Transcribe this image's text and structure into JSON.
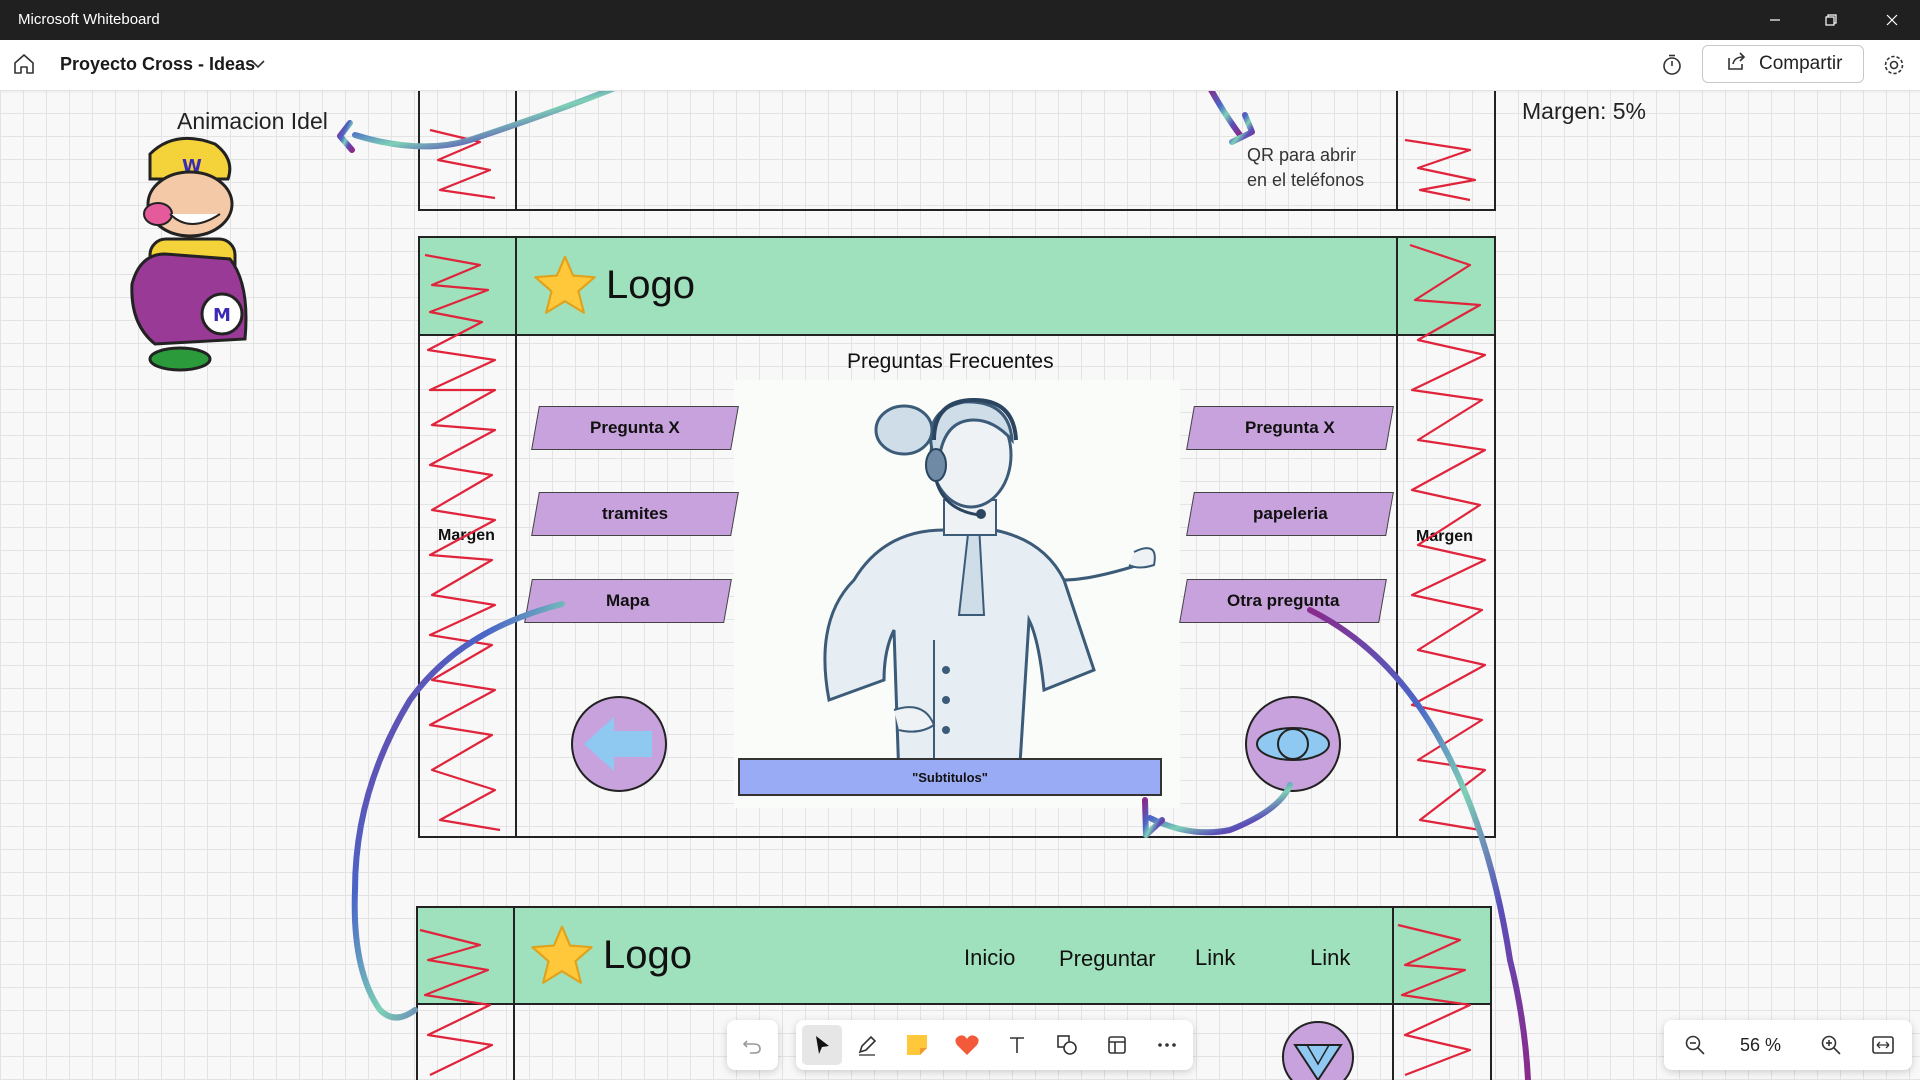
{
  "window": {
    "title": "Microsoft Whiteboard"
  },
  "header": {
    "board_title": "Proyecto Cross - Ideas",
    "share_label": "Compartir"
  },
  "canvas": {
    "note_animation": "Animacion Idel",
    "note_margin": "Margen: 5%",
    "note_qr_line1": "QR para abrir",
    "note_qr_line2": "en el teléfonos",
    "frame_main": {
      "logo": "Logo",
      "heading": "Preguntas Frecuentes",
      "left_buttons": [
        "Pregunta X",
        "tramites",
        "Mapa"
      ],
      "right_buttons": [
        "Pregunta X",
        "papeleria",
        "Otra pregunta"
      ],
      "margin_left": "Margen",
      "margin_right": "Margen",
      "subtitles": "\"Subtitulos\""
    },
    "frame_bottom": {
      "logo": "Logo",
      "nav": [
        "Inicio",
        "Preguntar",
        "Link",
        "Link"
      ]
    }
  },
  "toolbar": {
    "tools": [
      "undo-icon",
      "select-icon",
      "pen-icon",
      "sticky-note-icon",
      "reaction-icon",
      "text-icon",
      "shapes-icon",
      "template-icon",
      "more-icon"
    ]
  },
  "zoom": {
    "level": "56 %"
  },
  "colors": {
    "frame_green": "#9fe1bc",
    "button_purple": "#c8a2dc",
    "subtitle_blue": "#9aabf5",
    "scribble_red": "#e0243c"
  }
}
